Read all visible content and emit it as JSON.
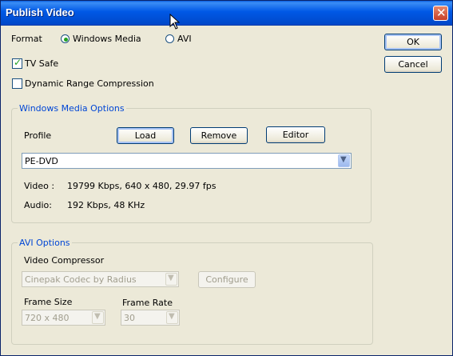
{
  "window": {
    "title": "Publish Video"
  },
  "format": {
    "label": "Format",
    "options": [
      {
        "label": "Windows Media",
        "selected": true
      },
      {
        "label": "AVI",
        "selected": false
      }
    ]
  },
  "checkboxes": {
    "tv_safe": {
      "label": "TV Safe",
      "checked": true
    },
    "dynamic_range": {
      "label": "Dynamic Range Compression",
      "checked": false
    }
  },
  "buttons": {
    "ok": "OK",
    "cancel": "Cancel"
  },
  "wm": {
    "title": "Windows Media Options",
    "profile_label": "Profile",
    "load": "Load",
    "remove": "Remove",
    "editor": "Editor",
    "profile_value": "PE-DVD",
    "video_label": "Video :",
    "video_value": "19799 Kbps, 640 x 480, 29.97 fps",
    "audio_label": "Audio:",
    "audio_value": "192 Kbps, 48 KHz"
  },
  "avi": {
    "title": "AVI Options",
    "compressor_label": "Video Compressor",
    "compressor_value": "Cinepak Codec by Radius",
    "configure": "Configure",
    "frame_size_label": "Frame Size",
    "frame_size_value": "720 x 480",
    "frame_rate_label": "Frame Rate",
    "frame_rate_value": "30"
  },
  "colors": {
    "title_bar": "#0058e6",
    "group_title": "#0046d5",
    "check": "#21a121"
  },
  "icons": {
    "close": "close-icon",
    "combo": "chevron-down-icon",
    "cursor": "mouse-cursor-icon"
  }
}
